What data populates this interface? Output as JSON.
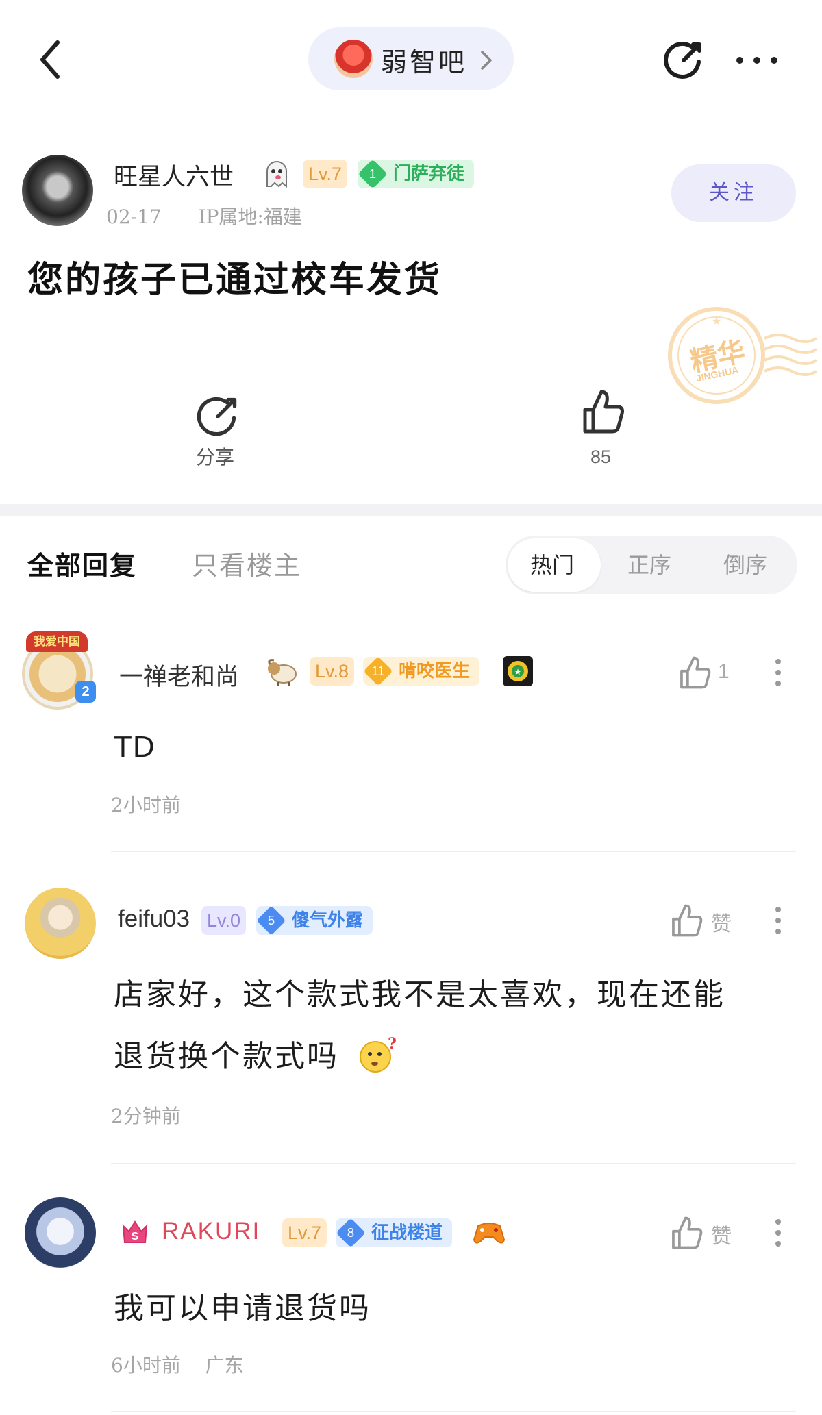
{
  "header": {
    "forum_name": "弱智吧"
  },
  "post": {
    "author": "旺星人六世",
    "level": "Lv.7",
    "honor_level": "1",
    "honor_title": "门萨弃徒",
    "date": "02-17",
    "ip": "IP属地:福建",
    "follow_label": "关注",
    "title": "您的孩子已通过校车发货",
    "stamp_text": "精华",
    "stamp_sub": "JINGHUA",
    "share_label": "分享",
    "like_count": "85"
  },
  "tabs": {
    "all": "全部回复",
    "op_only": "只看楼主",
    "sort": [
      "热门",
      "正序",
      "倒序"
    ],
    "active_sort": "热门"
  },
  "comments": [
    {
      "user": "一禅老和尚",
      "level": "Lv.8",
      "honor_level": "11",
      "honor_title": "啃咬医生",
      "avatar_frame_text": "我爱中国",
      "avatar_badge": "2",
      "text": "TD",
      "time": "2小时前",
      "likes": "1"
    },
    {
      "user": "feifu03",
      "level": "Lv.0",
      "honor_level": "5",
      "honor_title": "傻气外露",
      "text_line1": "店家好，这个款式我不是太喜欢，现在还能",
      "text_line2": "退货换个款式吗",
      "time": "2分钟前",
      "likes": "赞"
    },
    {
      "user": "RAKURI",
      "level": "Lv.7",
      "honor_level": "8",
      "honor_title": "征战楼道",
      "text": "我可以申请退货吗",
      "time": "6小时前",
      "location": "广东",
      "likes": "赞"
    }
  ],
  "colors": {
    "accent": "#5c56c7",
    "username_vip": "#e0485a",
    "honor_green": "#2cae5a",
    "honor_orange": "#f09a21",
    "honor_blue": "#3f83e8"
  }
}
